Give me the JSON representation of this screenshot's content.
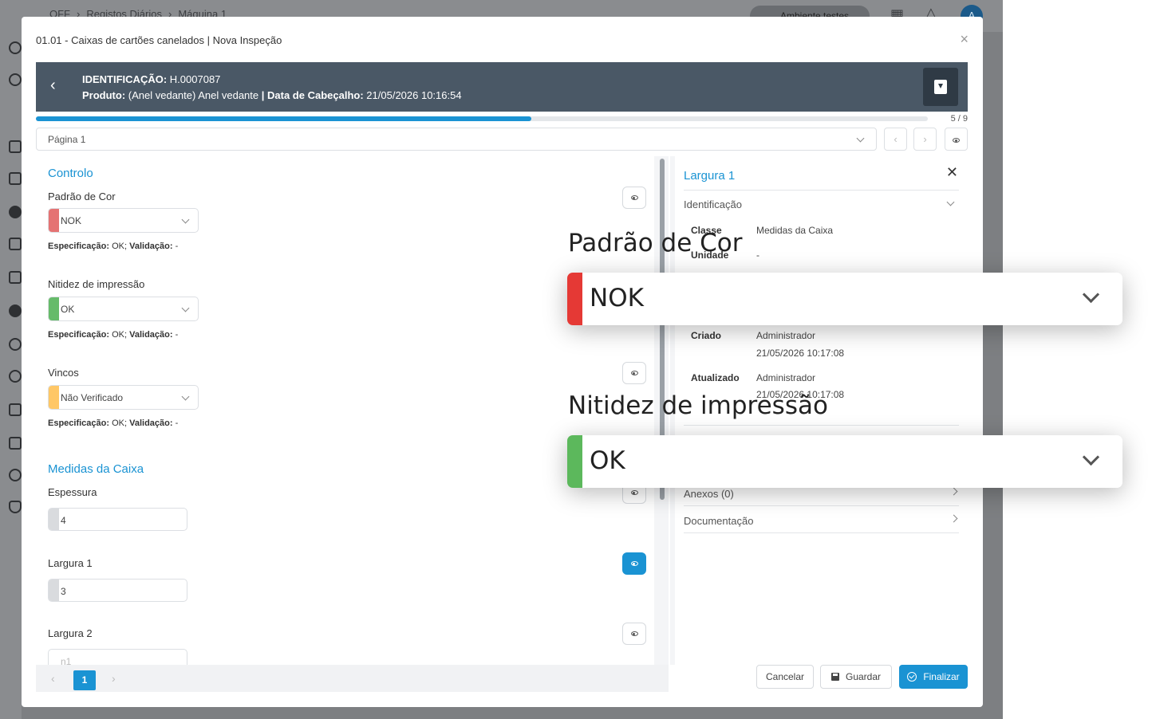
{
  "background": {
    "breadcrumb": [
      "OFF",
      "Registos Diários",
      "Máquina 1"
    ],
    "environment": "Ambiente testes",
    "avatar_initial": "A"
  },
  "modal": {
    "title": "01.01 - Caixas de cartões canelados | Nova Inspeção",
    "header": {
      "id_label": "IDENTIFICAÇÃO:",
      "id_value": "H.0007087",
      "product_label": "Produto:",
      "product_value": "(Anel vedante) Anel vedante",
      "sep": "|",
      "date_label": "Data de Cabeçalho:",
      "date_value": "21/05/2026 10:16:54"
    },
    "progress": {
      "current": 5,
      "total": 9,
      "label": "5 / 9"
    },
    "page_select": "Página 1"
  },
  "left": {
    "section_controlo": "Controlo",
    "section_medidas": "Medidas da Caixa",
    "spec_label": "Especificação:",
    "spec_value": "OK;",
    "val_label": "Validação:",
    "val_value": "-",
    "fields": [
      {
        "label": "Padrão de Cor",
        "value": "NOK",
        "color": "#e57373"
      },
      {
        "label": "Nitidez de impressão",
        "value": "OK",
        "color": "#66bb6a"
      },
      {
        "label": "Vincos",
        "value": "Não Verificado",
        "color": "#ffc766"
      }
    ],
    "numeric": [
      {
        "label": "Espessura",
        "value": "4"
      },
      {
        "label": "Largura 1",
        "value": "3"
      },
      {
        "label": "Largura 2",
        "placeholder": "n1"
      }
    ]
  },
  "right": {
    "title": "Largura 1",
    "identificacao": "Identificação",
    "rows": [
      {
        "key": "Classe",
        "value": "Medidas da Caixa"
      },
      {
        "key": "Unidade",
        "value": "-"
      },
      {
        "key": "Criado",
        "value": "Administrador",
        "value2": "21/05/2026 10:17:08"
      },
      {
        "key": "Atualizado",
        "value": "Administrador",
        "value2": "21/05/2026 10:17:08"
      }
    ],
    "anexos": "Anexos (0)",
    "documentacao": "Documentação"
  },
  "footer": {
    "page": "1",
    "cancel": "Cancelar",
    "save": "Guardar",
    "finish": "Finalizar"
  },
  "zoom": [
    {
      "label": "Padrão de Cor",
      "value": "NOK",
      "color": "#e53935"
    },
    {
      "label": "Nitidez de impressão",
      "value": "OK",
      "color": "#5cb85c"
    }
  ]
}
